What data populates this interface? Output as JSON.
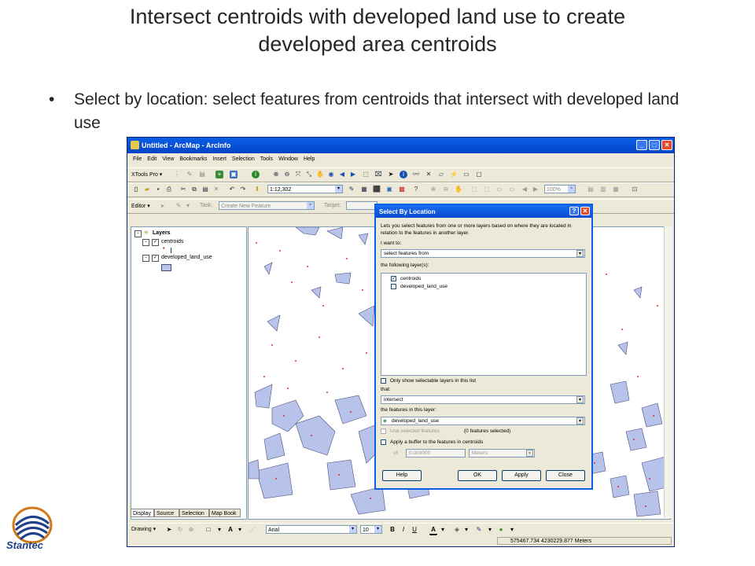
{
  "slide": {
    "title_line1": "Intersect centroids with developed land use to create",
    "title_line2": "developed area centroids",
    "bullet_marker": "•",
    "bullet_text": "Select by location: select features from centroids that intersect with developed land use"
  },
  "window": {
    "title": "Untitled - ArcMap - ArcInfo",
    "minimize": "_",
    "maximize": "□",
    "close": "✕"
  },
  "menu": [
    "File",
    "Edit",
    "View",
    "Bookmarks",
    "Insert",
    "Selection",
    "Tools",
    "Window",
    "Help"
  ],
  "toolbars": {
    "xtools_label": "XTools Pro ▾",
    "scale": "1:12,302",
    "zoom_pct": "100%",
    "editor_label": "Editor ▾",
    "task_label": "Task:",
    "task_value": "Create New Feature",
    "target_label": "Target:"
  },
  "toc": {
    "root": "Layers",
    "layers": [
      {
        "name": "centroids",
        "checked": true
      },
      {
        "name": "developed_land_use",
        "checked": true
      }
    ],
    "tabs": [
      "Display",
      "Source",
      "Selection",
      "Map Book"
    ]
  },
  "drawing": {
    "drawing_label": "Drawing ▾",
    "font_name": "Arial",
    "font_size": "10",
    "bold": "B",
    "italic": "I",
    "underline": "U"
  },
  "status": {
    "coordinates": "575467.734  4230229.877 Meters"
  },
  "dialog": {
    "title": "Select By Location",
    "help_q": "?",
    "close_x": "✕",
    "description": "Lets you select features from one or more layers based on where they are located in relation to the features in another layer.",
    "i_want_to_label": "I want to:",
    "i_want_to_value": "select features from",
    "following_layers_label": "the following layer(s):",
    "layers": [
      {
        "name": "centroids",
        "checked": true
      },
      {
        "name": "developed_land_use",
        "checked": false
      }
    ],
    "only_selectable": "Only show selectable layers in this list",
    "that_label": "that:",
    "that_value": "intersect",
    "features_in_layer_label": "the features in this layer:",
    "features_in_layer_value": "developed_land_use",
    "use_selected": "Use selected features",
    "features_selected": "(0 features selected)",
    "apply_buffer": "Apply a buffer to the features in centroids",
    "of_label": "of:",
    "buffer_value": "0.000000",
    "units_value": "Meters",
    "buttons": {
      "help": "Help",
      "ok": "OK",
      "apply": "Apply",
      "close": "Close"
    }
  },
  "logo": {
    "company": "Stantec"
  },
  "colors": {
    "polygon_fill": "#b8c3ec",
    "polygon_stroke": "#4a4f7a",
    "point": "#e03030",
    "titlebar": "#0a5ee8"
  }
}
